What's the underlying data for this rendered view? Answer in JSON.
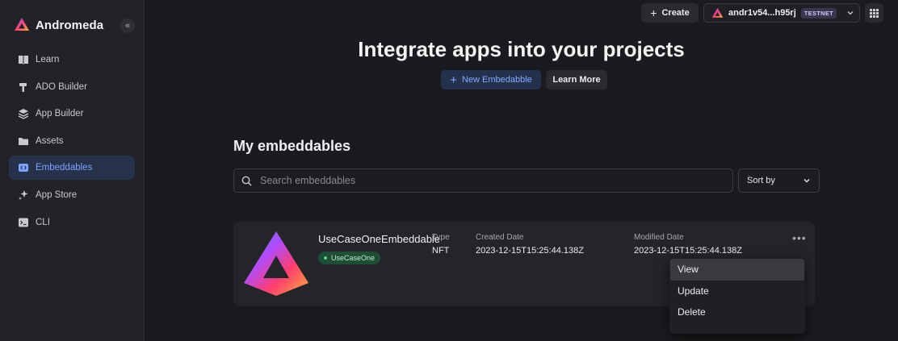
{
  "app": {
    "name": "Andromeda"
  },
  "sidebar": {
    "collapse_glyph": "«",
    "items": [
      {
        "label": "Learn",
        "icon": "book-icon",
        "active": false
      },
      {
        "label": "ADO Builder",
        "icon": "hammer-icon",
        "active": false
      },
      {
        "label": "App Builder",
        "icon": "layers-icon",
        "active": false
      },
      {
        "label": "Assets",
        "icon": "folder-icon",
        "active": false
      },
      {
        "label": "Embeddables",
        "icon": "embed-icon",
        "active": true
      },
      {
        "label": "App Store",
        "icon": "sparkle-icon",
        "active": false
      },
      {
        "label": "CLI",
        "icon": "terminal-icon",
        "active": false
      }
    ]
  },
  "topbar": {
    "create_label": "Create",
    "wallet_address": "andr1v54...h95rj",
    "network_badge": "TESTNET"
  },
  "hero": {
    "title": "Integrate apps into your projects",
    "new_button": "New Embedabble",
    "learn_more": "Learn More"
  },
  "section": {
    "title": "My embeddables",
    "search_placeholder": "Search embeddables",
    "sort_label": "Sort by"
  },
  "card": {
    "name": "UseCaseOneEmbeddable",
    "badge": "UseCaseOne",
    "type_label": "Type",
    "type_value": "NFT",
    "created_label": "Created Date",
    "created_value": "2023-12-15T15:25:44.138Z",
    "modified_label": "Modified Date",
    "modified_value": "2023-12-15T15:25:44.138Z"
  },
  "menu": {
    "items": [
      "View",
      "Update",
      "Delete"
    ],
    "hovered_index": 0
  },
  "colors": {
    "accent": "#7aa2ff",
    "background": "#1a1b1e",
    "sidebar": "#222327",
    "badge_green": "#1f4d35"
  }
}
